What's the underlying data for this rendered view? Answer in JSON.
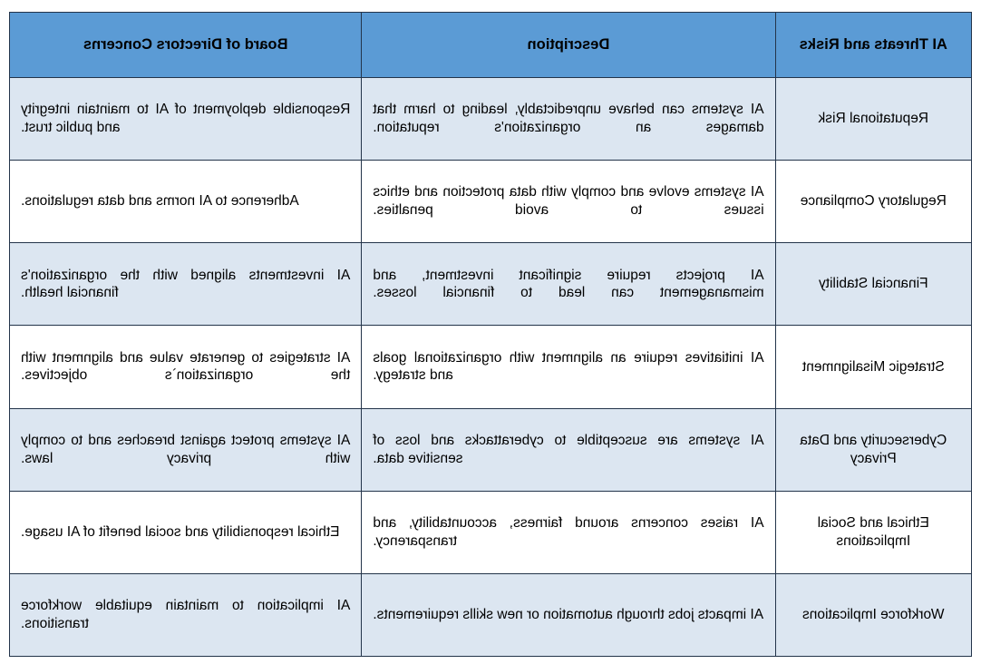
{
  "table": {
    "columns": [
      {
        "key": "risk",
        "label": "AI Threats and Risks"
      },
      {
        "key": "desc",
        "label": "Description"
      },
      {
        "key": "board",
        "label": "Board of Directors Concerns"
      }
    ],
    "colors": {
      "header_background": "#5B9BD5",
      "header_text": "#000000",
      "row_shaded_background": "#DCE6F1",
      "row_plain_background": "#FFFFFF",
      "border": "#23344A",
      "page_background": "#FFFFFF"
    },
    "rows": [
      {
        "risk": "Reputational Risk",
        "desc": "AI systems can behave unpredictably, leading to harm that damages an organization's reputation.",
        "board": "Responsible deployment of AI to maintain integrity and public trust."
      },
      {
        "risk": "Regulatory Compliance",
        "desc": "AI systems evolve and comply with data protection and ethics issues to avoid penalties.",
        "board": "Adherence to AI norms and data regulations."
      },
      {
        "risk": "Financial Stability",
        "desc": "AI projects require significant investment, and mismanagement can lead to financial losses.",
        "board": "AI investments aligned with the organization's financial health."
      },
      {
        "risk": "Strategic Misalignment",
        "desc": "AI initiatives require an alignment with organizational goals and strategy.",
        "board": "AI strategies to generate value and alignment with the organization`s objectives."
      },
      {
        "risk": "Cybersecurity and Data Privacy",
        "desc": "AI systems are susceptible to cyberattacks and loss of sensitive data.",
        "board": "AI systems protect against breaches and to comply with privacy laws."
      },
      {
        "risk": "Ethical and Social Implications",
        "desc": "AI raises concerns around fairness, accountability, and transparency.",
        "board": "Ethical responsibility and social benefit of AI usage."
      },
      {
        "risk": "Workforce Implications",
        "desc": "AI impacts jobs through automation or new skills requirements.",
        "board": "AI implication to maintain equitable workforce transitions."
      }
    ]
  }
}
